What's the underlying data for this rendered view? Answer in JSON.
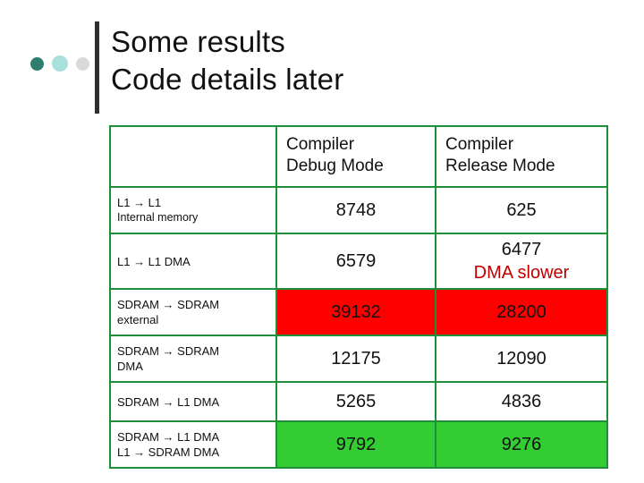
{
  "slide": {
    "title_line1": "Some results",
    "title_line2": "Code details later"
  },
  "decor": {
    "dot1": "#2e7d6f",
    "dot2": "#a8e0dc",
    "dot3": "#d9d9d9",
    "rule": "#2e2e2e"
  },
  "table": {
    "border_color": "#1f8f3a",
    "highlight_red": "#ff0000",
    "highlight_green": "#33cc33",
    "header": {
      "corner": "",
      "col1_line1": "Compiler",
      "col1_line2": "Debug Mode",
      "col2_line1": "Compiler",
      "col2_line2": "Release Mode"
    },
    "rows": [
      {
        "label_line1": "L1 → L1",
        "label_line2": "Internal memory",
        "debug": "8748",
        "release": "625",
        "debug_note": "",
        "release_note": "",
        "fill": "none"
      },
      {
        "label_line1": "L1 → L1 DMA",
        "label_line2": "",
        "debug": "6579",
        "release": "6477",
        "debug_note": "",
        "release_note": "DMA slower",
        "fill": "none"
      },
      {
        "label_line1": "SDRAM → SDRAM",
        "label_line2": "external",
        "debug": "39132",
        "release": "28200",
        "debug_note": "",
        "release_note": "",
        "fill": "red"
      },
      {
        "label_line1": "SDRAM → SDRAM",
        "label_line2": "DMA",
        "debug": "12175",
        "release": "12090",
        "debug_note": "",
        "release_note": "",
        "fill": "none"
      },
      {
        "label_line1": "SDRAM → L1 DMA",
        "label_line2": "",
        "debug": "5265",
        "release": "4836",
        "debug_note": "",
        "release_note": "",
        "fill": "none"
      },
      {
        "label_line1": "SDRAM → L1 DMA",
        "label_line2": "L1 → SDRAM DMA",
        "debug": "9792",
        "release": "9276",
        "debug_note": "",
        "release_note": "",
        "fill": "green"
      }
    ]
  }
}
